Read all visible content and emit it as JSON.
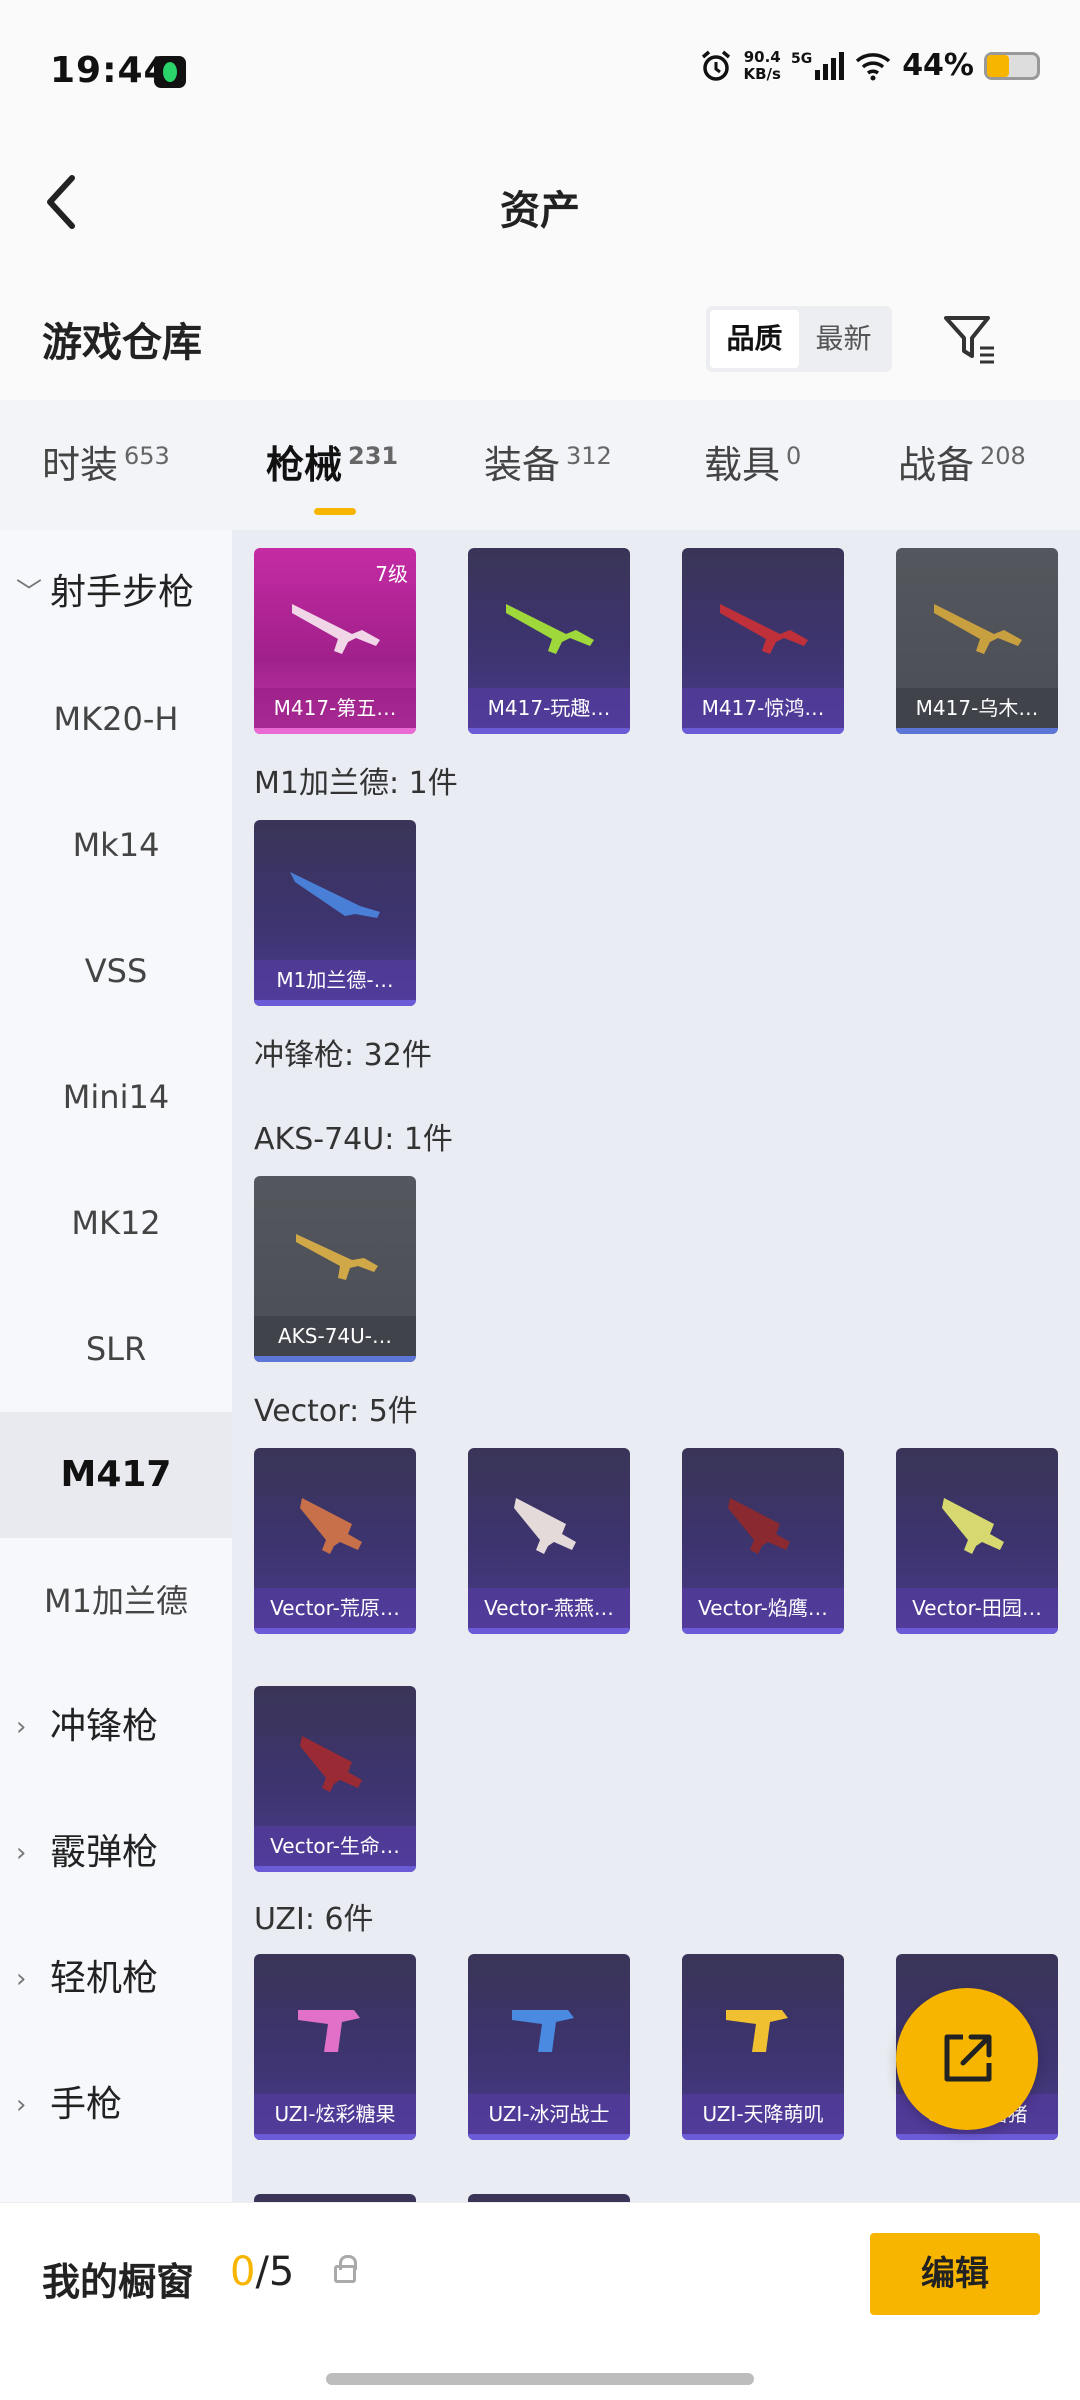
{
  "status_bar": {
    "time": "19:44",
    "speed_value": "90.4",
    "speed_unit": "KB/s",
    "network": "5G",
    "battery": "44%",
    "battery_level": 0.44
  },
  "header": {
    "title": "资产"
  },
  "section": {
    "title": "游戏仓库",
    "sort_quality": "品质",
    "sort_newest": "最新"
  },
  "tabs": [
    {
      "label": "时装",
      "count": "653"
    },
    {
      "label": "枪械",
      "count": "231"
    },
    {
      "label": "装备",
      "count": "312"
    },
    {
      "label": "载具",
      "count": "0"
    },
    {
      "label": "战备",
      "count": "208"
    }
  ],
  "sidebar": [
    {
      "label": "射手步枪",
      "type": "group-open"
    },
    {
      "label": "MK20-H"
    },
    {
      "label": "Mk14"
    },
    {
      "label": "VSS"
    },
    {
      "label": "Mini14"
    },
    {
      "label": "MK12"
    },
    {
      "label": "SLR"
    },
    {
      "label": "M417",
      "active": true
    },
    {
      "label": "M1加兰德"
    },
    {
      "label": "冲锋枪",
      "type": "group"
    },
    {
      "label": "霰弹枪",
      "type": "group"
    },
    {
      "label": "轻机枪",
      "type": "group"
    },
    {
      "label": "手枪",
      "type": "group"
    }
  ],
  "content": {
    "m417_items": [
      {
        "label": "M417-第五…",
        "level": "7级"
      },
      {
        "label": "M417-玩趣…"
      },
      {
        "label": "M417-惊鸿…"
      },
      {
        "label": "M417-乌木…"
      }
    ],
    "m1_header": "M1加兰德: 1件",
    "m1_items": [
      {
        "label": "M1加兰德-…"
      }
    ],
    "smg_header": "冲锋枪: 32件",
    "aks_header": "AKS-74U: 1件",
    "aks_items": [
      {
        "label": "AKS-74U-…"
      }
    ],
    "vector_header": "Vector: 5件",
    "vector_items": [
      {
        "label": "Vector-荒原…"
      },
      {
        "label": "Vector-燕燕…"
      },
      {
        "label": "Vector-焰鹰…"
      },
      {
        "label": "Vector-田园…"
      },
      {
        "label": "Vector-生命…"
      }
    ],
    "uzi_header": "UZI: 6件",
    "uzi_items": [
      {
        "label": "UZI-炫彩糖果"
      },
      {
        "label": "UZI-冰河战士"
      },
      {
        "label": "UZI-天降萌叽"
      },
      {
        "label": "UZI-…猪猪"
      }
    ]
  },
  "bottom": {
    "showcase_label": "我的橱窗",
    "count_used": "0",
    "count_total": "/5",
    "edit_label": "编辑"
  },
  "colors": {
    "accent": "#f7b500",
    "epic_purple": "#4a3c8a",
    "legend_pink": "#c52ba4"
  }
}
